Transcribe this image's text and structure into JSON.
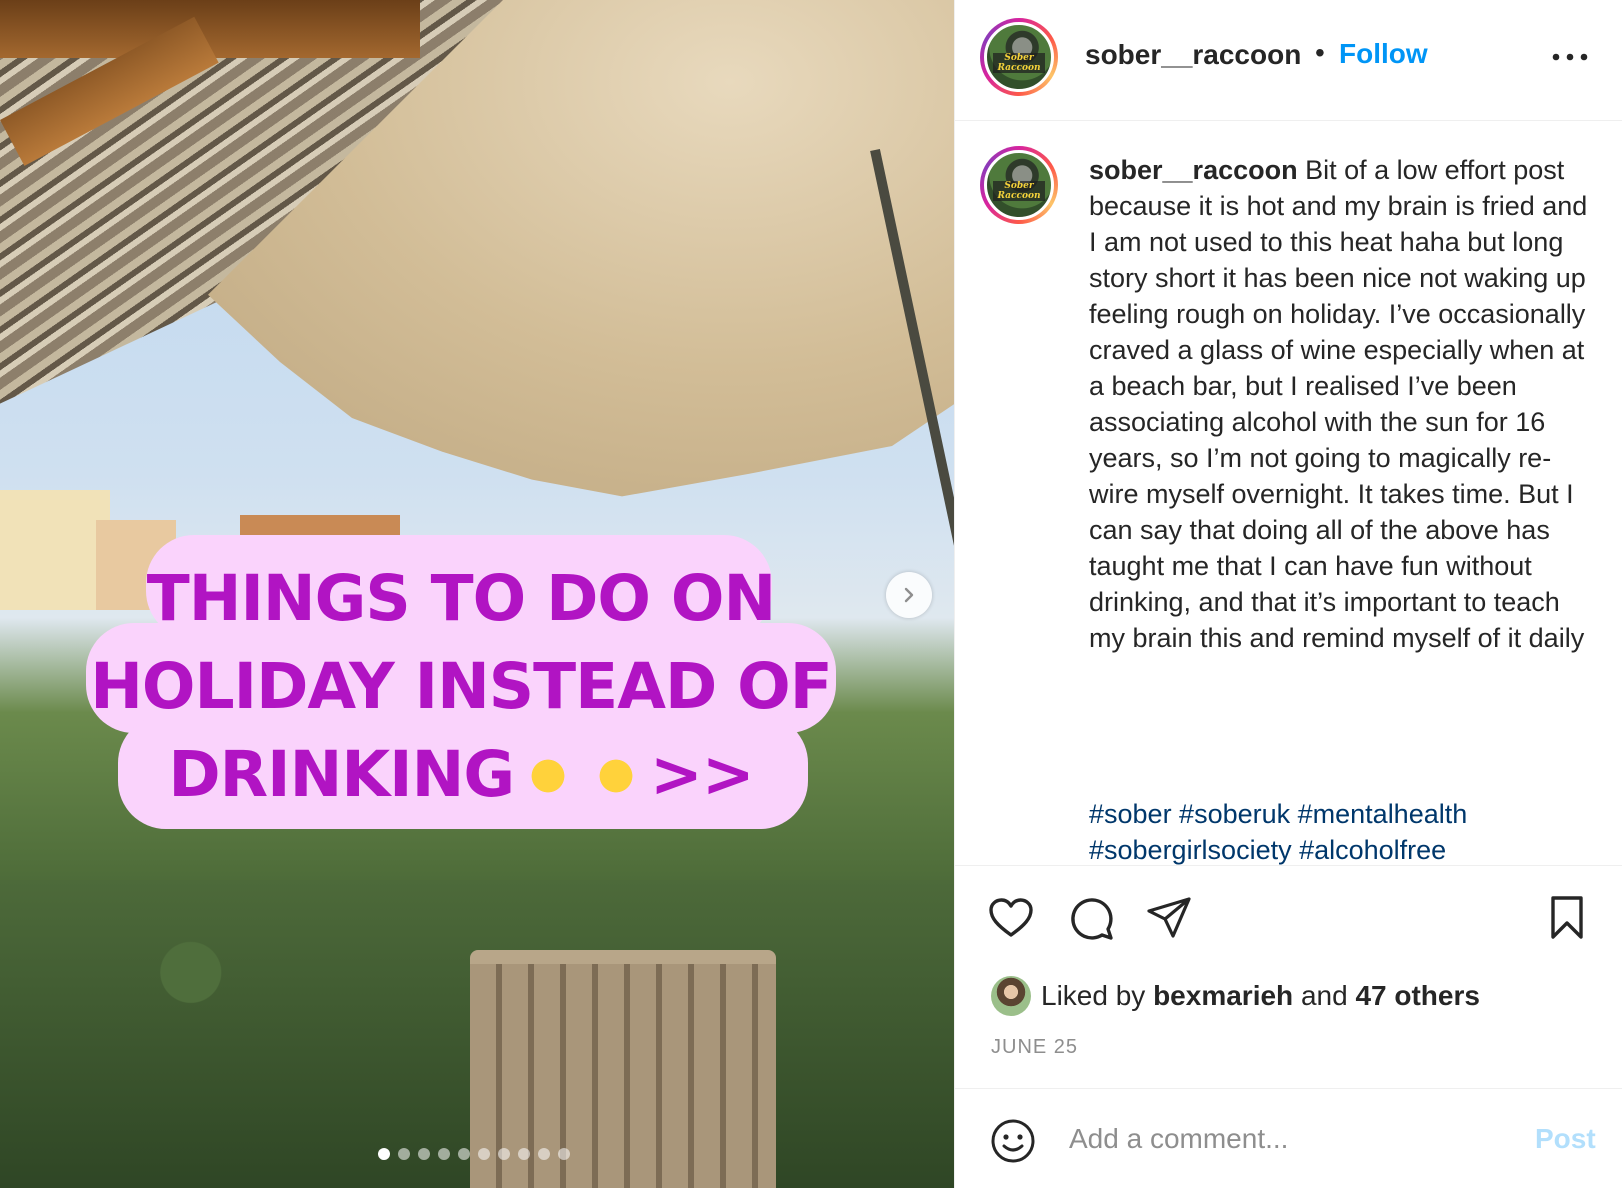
{
  "post": {
    "username": "sober__raccoon",
    "separator": "•",
    "follow_label": "Follow",
    "avatar_text": "Sober Raccoon"
  },
  "media": {
    "overlay_lines": [
      "THINGS TO DO ON",
      "HOLIDAY INSTEAD OF",
      "DRINKING"
    ],
    "overlay_arrows": ">>",
    "slide_count": 10,
    "active_slide": 1
  },
  "caption": {
    "username": "sober__raccoon",
    "body": "Bit of a low effort post because it is hot and my brain is fried and I am not used to this heat haha but long story short it has been nice not waking up feeling rough on holiday. I’ve occasionally craved a glass of wine especially when at a beach bar, but I realised I’ve been associating alcohol with the sun for 16 years, so I’m not going to magically re-wire myself overnight. It takes time. But I can say that doing all of the above has taught me that I can have fun without drinking, and that it’s important to teach my brain this and remind myself of it daily",
    "hashtags_line1": "#sober #soberuk #mentalhealth",
    "hashtags_line2": "#sobergirlsociety #alcoholfree"
  },
  "likes": {
    "prefix": "Liked by",
    "user": "bexmarieh",
    "conj": "and",
    "others": "47 others"
  },
  "date": "JUNE 25",
  "comment": {
    "placeholder": "Add a comment...",
    "post_label": "Post"
  },
  "colors": {
    "accent": "#0095f6",
    "overlay_text": "#b114c3",
    "overlay_bg": "#fad3fc",
    "hashtag": "#00376b"
  }
}
